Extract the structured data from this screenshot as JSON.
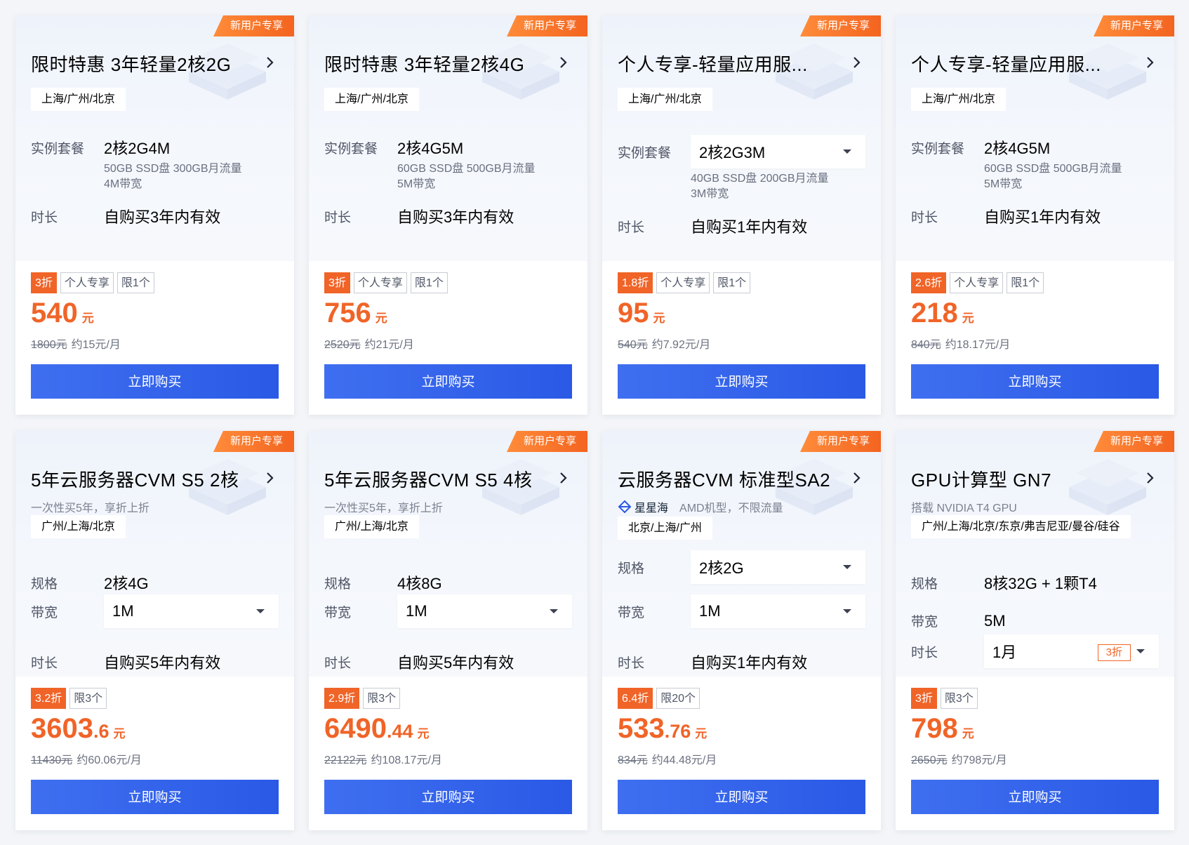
{
  "ribbon": "新用户专享",
  "buy_label": "立即购买",
  "labels": {
    "package": "实例套餐",
    "duration": "时长",
    "spec": "规格",
    "bandwidth": "带宽"
  },
  "cards": [
    {
      "title": "限时特惠 3年轻量2核2G",
      "region": "上海/广州/北京",
      "package": "2核2G4M",
      "detail1": "50GB SSD盘 300GB月流量",
      "detail2": "4M带宽",
      "duration": "自购买3年内有效",
      "discount": "3折",
      "tags": [
        "个人专享",
        "限1个"
      ],
      "price_int": "540",
      "price_dec": "",
      "unit": "元",
      "orig": "1800元",
      "monthly": "约15元/月"
    },
    {
      "title": "限时特惠 3年轻量2核4G",
      "region": "上海/广州/北京",
      "package": "2核4G5M",
      "detail1": "60GB SSD盘 500GB月流量",
      "detail2": "5M带宽",
      "duration": "自购买3年内有效",
      "discount": "3折",
      "tags": [
        "个人专享",
        "限1个"
      ],
      "price_int": "756",
      "price_dec": "",
      "unit": "元",
      "orig": "2520元",
      "monthly": "约21元/月"
    },
    {
      "title": "个人专享-轻量应用服...",
      "region": "上海/广州/北京",
      "package": "2核2G3M",
      "detail1": "40GB SSD盘 200GB月流量",
      "detail2": "3M带宽",
      "duration": "自购买1年内有效",
      "discount": "1.8折",
      "tags": [
        "个人专享",
        "限1个"
      ],
      "price_int": "95",
      "price_dec": "",
      "unit": "元",
      "orig": "540元",
      "monthly": "约7.92元/月"
    },
    {
      "title": "个人专享-轻量应用服...",
      "region": "上海/广州/北京",
      "package": "2核4G5M",
      "detail1": "60GB SSD盘 500GB月流量",
      "detail2": "5M带宽",
      "duration": "自购买1年内有效",
      "discount": "2.6折",
      "tags": [
        "个人专享",
        "限1个"
      ],
      "price_int": "218",
      "price_dec": "",
      "unit": "元",
      "orig": "840元",
      "monthly": "约18.17元/月"
    },
    {
      "title": "5年云服务器CVM S5 2核",
      "subtitle": "一次性买5年，享折上折",
      "region": "广州/上海/北京",
      "spec": "2核4G",
      "bandwidth": "1M",
      "duration": "自购买5年内有效",
      "discount": "3.2折",
      "tags": [
        "限3个"
      ],
      "price_int": "3603",
      "price_dec": ".6",
      "unit": "元",
      "orig": "11430元",
      "monthly": "约60.06元/月"
    },
    {
      "title": "5年云服务器CVM S5 4核",
      "subtitle": "一次性买5年，享折上折",
      "region": "广州/上海/北京",
      "spec": "4核8G",
      "bandwidth": "1M",
      "duration": "自购买5年内有效",
      "discount": "2.9折",
      "tags": [
        "限3个"
      ],
      "price_int": "6490",
      "price_dec": ".44",
      "unit": "元",
      "orig": "22122元",
      "monthly": "约108.17元/月"
    },
    {
      "title": "云服务器CVM 标准型SA2",
      "brand": "星星海",
      "subtitle": "AMD机型，不限流量",
      "region": "北京/上海/广州",
      "spec": "2核2G",
      "bandwidth": "1M",
      "duration": "自购买1年内有效",
      "discount": "6.4折",
      "tags": [
        "限20个"
      ],
      "price_int": "533",
      "price_dec": ".76",
      "unit": "元",
      "orig": "834元",
      "monthly": "约44.48元/月"
    },
    {
      "title": "GPU计算型 GN7",
      "subtitle": "搭载 NVIDIA T4 GPU",
      "region": "广州/上海/北京/东京/弗吉尼亚/曼谷/硅谷",
      "spec": "8核32G + 1颗T4",
      "bandwidth": "5M",
      "duration": "1月",
      "duration_tag": "3折",
      "discount": "3折",
      "tags": [
        "限3个"
      ],
      "price_int": "798",
      "price_dec": "",
      "unit": "元",
      "orig": "2650元",
      "monthly": "约798元/月"
    }
  ]
}
